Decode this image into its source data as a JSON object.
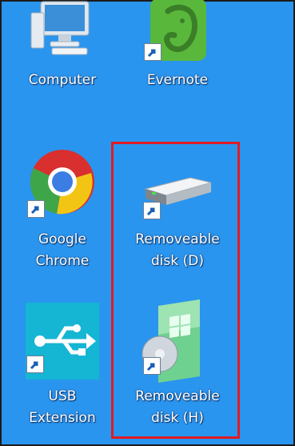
{
  "desktop": {
    "icons": [
      {
        "label": "Computer",
        "icon": "computer-icon",
        "shortcut": false
      },
      {
        "label": "Evernote",
        "icon": "evernote-icon",
        "shortcut": true
      },
      {
        "label_line1": "Google",
        "label_line2": "Chrome",
        "icon": "chrome-icon",
        "shortcut": true
      },
      {
        "label_line1": "Removeable",
        "label_line2": "disk (D)",
        "icon": "removable-drive-icon",
        "shortcut": true
      },
      {
        "label_line1": "USB",
        "label_line2": "Extension",
        "icon": "usb-icon",
        "shortcut": true
      },
      {
        "label_line1": "Removeable",
        "label_line2": "disk (H)",
        "icon": "windows-disc-box-icon",
        "shortcut": true
      }
    ],
    "colors": {
      "background": "#2a95ee",
      "selection": "#e21b24",
      "evernote": "#59b83b",
      "usb": "#15b5d4"
    }
  }
}
